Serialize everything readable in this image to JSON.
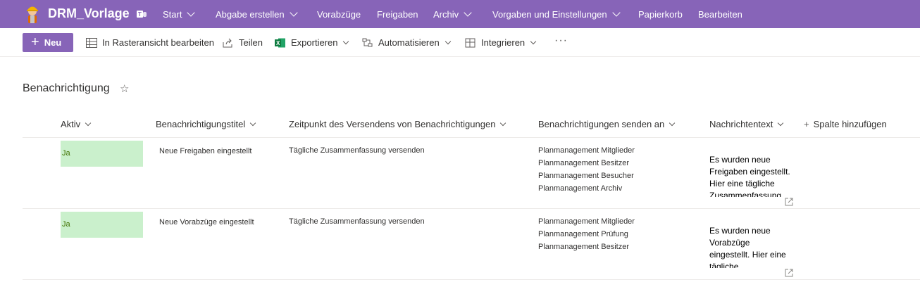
{
  "suite": {
    "site_title": "DRM_Vorlage",
    "nav": [
      {
        "label": "Start",
        "has_dropdown": true
      },
      {
        "label": "Abgabe erstellen",
        "has_dropdown": true
      },
      {
        "label": "Vorabzüge",
        "has_dropdown": false
      },
      {
        "label": "Freigaben",
        "has_dropdown": false
      },
      {
        "label": "Archiv",
        "has_dropdown": true
      },
      {
        "label": "Vorgaben und Einstellungen",
        "has_dropdown": true
      },
      {
        "label": "Papierkorb",
        "has_dropdown": false
      },
      {
        "label": "Bearbeiten",
        "has_dropdown": false
      }
    ],
    "accent": "#8764b8"
  },
  "commands": {
    "new_label": "Neu",
    "grid_label": "In Rasteransicht bearbeiten",
    "share_label": "Teilen",
    "export_label": "Exportieren",
    "automate_label": "Automatisieren",
    "integrate_label": "Integrieren",
    "more_label": "···"
  },
  "list": {
    "title": "Benachrichtigung",
    "columns": [
      "Aktiv",
      "Benachrichtigungstitel",
      "Zeitpunkt des Versendens von Benachrichtigungen",
      "Benachrichtigungen senden an",
      "Nachrichtentext"
    ],
    "add_column_label": "Spalte hinzufügen",
    "rows": [
      {
        "aktiv": "Ja",
        "titel": "Neue Freigaben eingestellt",
        "zeitpunkt": "Tägliche Zusammenfassung versenden",
        "empfaenger": [
          "Planmanagement Mitglieder",
          "Planmanagement Besitzer",
          "Planmanagement Besucher",
          "Planmanagement Archiv"
        ],
        "nachricht": [
          "Es wurden neue",
          "Freigaben eingestellt.",
          "Hier eine tägliche",
          "Zusammenfassung"
        ]
      },
      {
        "aktiv": "Ja",
        "titel": "Neue Vorabzüge eingestellt",
        "zeitpunkt": "Tägliche Zusammenfassung versenden",
        "empfaenger": [
          "Planmanagement Mitglieder",
          "Planmanagement Prüfung",
          "Planmanagement Besitzer"
        ],
        "nachricht": [
          "Es wurden neue",
          "Vorabzüge",
          "eingestellt. Hier eine",
          "tägliche"
        ]
      }
    ]
  }
}
